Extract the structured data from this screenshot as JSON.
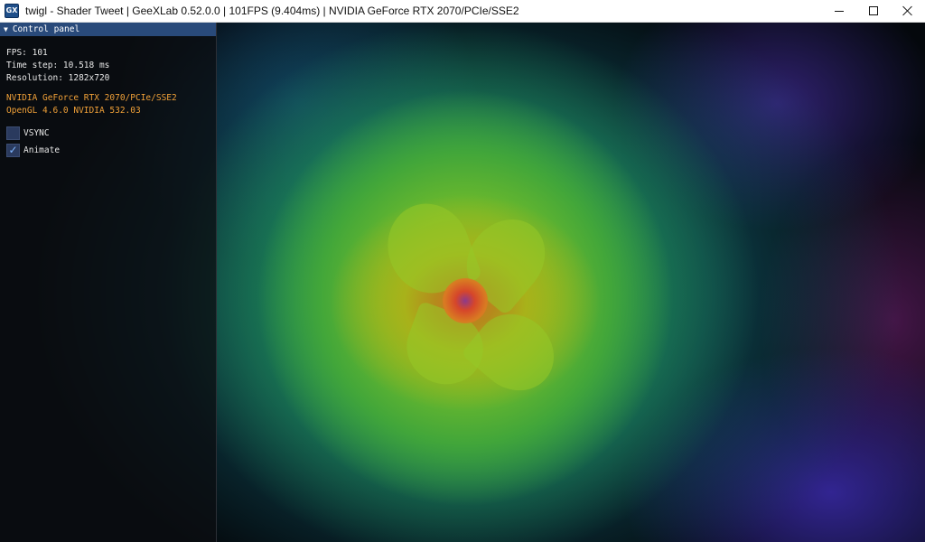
{
  "window": {
    "title": "twigl - Shader Tweet | GeeXLab 0.52.0.0 | 101FPS (9.404ms) | NVIDIA GeForce RTX 2070/PCIe/SSE2",
    "icon": "geexlab-app-icon",
    "icon_text": "GX",
    "controls": {
      "minimize": "minimize-icon",
      "maximize": "maximize-icon",
      "close": "close-icon"
    }
  },
  "panel": {
    "title": "Control panel",
    "collapse_icon": "triangle-down-icon",
    "fps": "FPS: 101",
    "time_step": "Time step: 10.518 ms",
    "resolution": "Resolution: 1282x720",
    "gpu": "NVIDIA GeForce RTX 2070/PCIe/SSE2",
    "opengl": "OpenGL 4.6.0 NVIDIA 532.03",
    "checkboxes": [
      {
        "label": "VSYNC",
        "checked": false,
        "check_mark": ""
      },
      {
        "label": "Animate",
        "checked": true,
        "check_mark": "✓"
      }
    ]
  },
  "colors": {
    "panel_header": "#294a7a",
    "info_orange": "#f0a038",
    "checkbox_fill": "#2a3a5e",
    "check_mark": "#7fb6ff"
  }
}
